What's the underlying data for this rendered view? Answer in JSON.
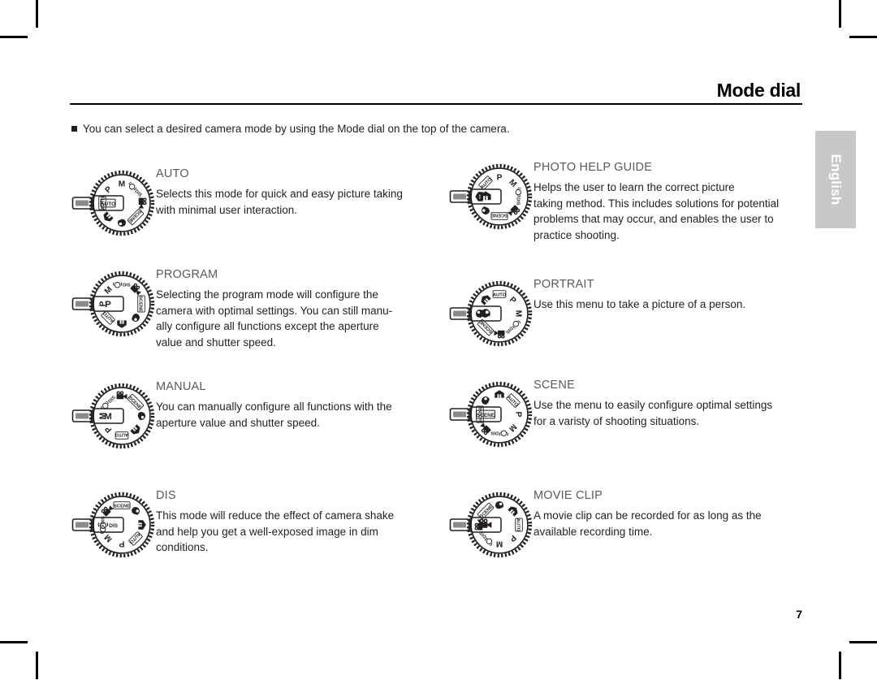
{
  "document": {
    "title": "Mode dial",
    "page_number": "7",
    "language_tab": "English",
    "intro": "You can select a desired camera mode by using the Mode dial on the top of the camera.",
    "bullet_glyph": "square"
  },
  "dial_positions": [
    "AUTO",
    "P",
    "M",
    "DIS",
    "MOVIE",
    "SCENE",
    "PORTRAIT",
    "HELP"
  ],
  "modes": [
    {
      "id": "auto",
      "column": "left",
      "title": "AUTO",
      "selected": "AUTO",
      "body": [
        "Selects this mode for quick and easy picture taking",
        "with minimal user interaction."
      ]
    },
    {
      "id": "program",
      "column": "left",
      "title": "PROGRAM",
      "selected": "P",
      "body": [
        "Selecting the program mode will configure the",
        "camera with optimal settings. You can still manu-",
        "ally configure all functions except the aperture",
        "value and shutter speed."
      ]
    },
    {
      "id": "manual",
      "column": "left",
      "title": "MANUAL",
      "selected": "M",
      "body": [
        "You can manually configure all functions with the",
        "aperture value and shutter speed."
      ]
    },
    {
      "id": "dis",
      "column": "left",
      "title": "DIS",
      "selected": "DIS",
      "body": [
        "This mode will reduce the effect of camera shake",
        "and help you get a well-exposed image in dim",
        "conditions."
      ]
    },
    {
      "id": "photo-help-guide",
      "column": "right",
      "title": "PHOTO HELP GUIDE",
      "selected": "HELP",
      "body": [
        "Helps the user to learn the correct picture",
        "taking method. This includes solutions for potential",
        "problems that may occur, and enables the user to",
        "practice shooting."
      ]
    },
    {
      "id": "portrait",
      "column": "right",
      "title": "PORTRAIT",
      "selected": "PORTRAIT",
      "body": [
        "Use this menu to take a picture of a person."
      ]
    },
    {
      "id": "scene",
      "column": "right",
      "title": "SCENE",
      "selected": "SCENE",
      "body": [
        "Use the menu to easily configure optimal settings",
        "for a varisty of shooting situations."
      ]
    },
    {
      "id": "movie-clip",
      "column": "right",
      "title": "MOVIE CLIP",
      "selected": "MOVIE",
      "body": [
        "A movie clip can be recorded for as long as the",
        "available recording time."
      ]
    }
  ],
  "colors": {
    "ink": "#231f20",
    "heading_gray": "#5a5a5a",
    "tab_gray": "#c8c8c8",
    "tab_text": "#ffffff",
    "rule": "#000000"
  }
}
